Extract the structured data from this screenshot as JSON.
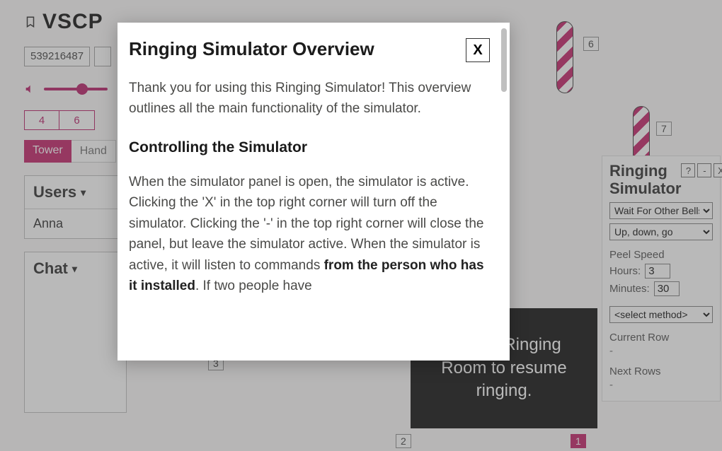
{
  "brand": "VSCP",
  "room_id": "539216487",
  "bell_count": {
    "a": "4",
    "b": "6"
  },
  "tabs": {
    "tower": "Tower",
    "hand": "Hand"
  },
  "users": {
    "title": "Users",
    "items": [
      "Anna"
    ]
  },
  "chat": {
    "title": "Chat"
  },
  "bell_labels": {
    "b1": "1",
    "b2": "2",
    "b3": "3",
    "b6": "6",
    "b7": "7"
  },
  "toast": "here in Ringing Room to resume ringing.",
  "sim": {
    "title": "Ringing Simulator",
    "help": "?",
    "min": "-",
    "close": "X",
    "mode": "Wait For Other Bells",
    "call": "Up, down, go",
    "peel_label": "Peel Speed",
    "hours_label": "Hours:",
    "hours": "3",
    "minutes_label": "Minutes:",
    "minutes": "30",
    "method": "<select method>",
    "current_row_label": "Current Row",
    "current_row": "-",
    "next_rows_label": "Next Rows",
    "next_rows": "-"
  },
  "modal": {
    "title": "Ringing Simulator Overview",
    "close": "X",
    "p1": "Thank you for using this Ringing Simulator! This overview outlines all the main functionality of the simulator.",
    "h2": "Controlling the Simulator",
    "p2a": "When the simulator panel is open, the simulator is active. Clicking the 'X' in the top right corner will turn off the simulator. Clicking the '-' in the top right corner will close the panel, but leave the simulator active. When the simulator is active, it will listen to commands ",
    "p2b": "from the person who has it installed",
    "p2c": ". If two people have"
  }
}
